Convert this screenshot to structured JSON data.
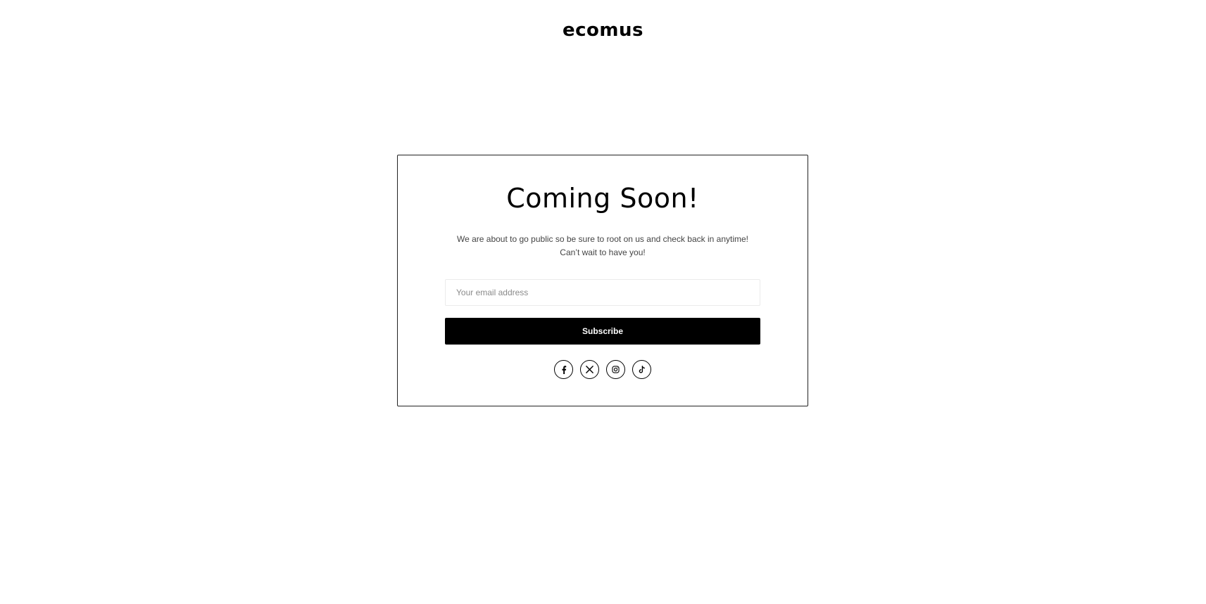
{
  "brand": {
    "logo_text": "ecomus"
  },
  "card": {
    "title": "Coming Soon!",
    "description_line1": "We are about to go public so be sure to root on us and check back in anytime!",
    "description_line2": "Can’t wait to have you!"
  },
  "form": {
    "email_placeholder": "Your email address",
    "email_value": "",
    "subscribe_label": "Subscribe"
  },
  "social": {
    "icons": [
      "facebook-icon",
      "x-twitter-icon",
      "instagram-icon",
      "tiktok-icon"
    ]
  },
  "colors": {
    "background": "#ffffff",
    "text": "#000000",
    "button_bg": "#000000",
    "button_text": "#ffffff",
    "muted_text": "#444444",
    "input_border": "#ebebeb"
  }
}
